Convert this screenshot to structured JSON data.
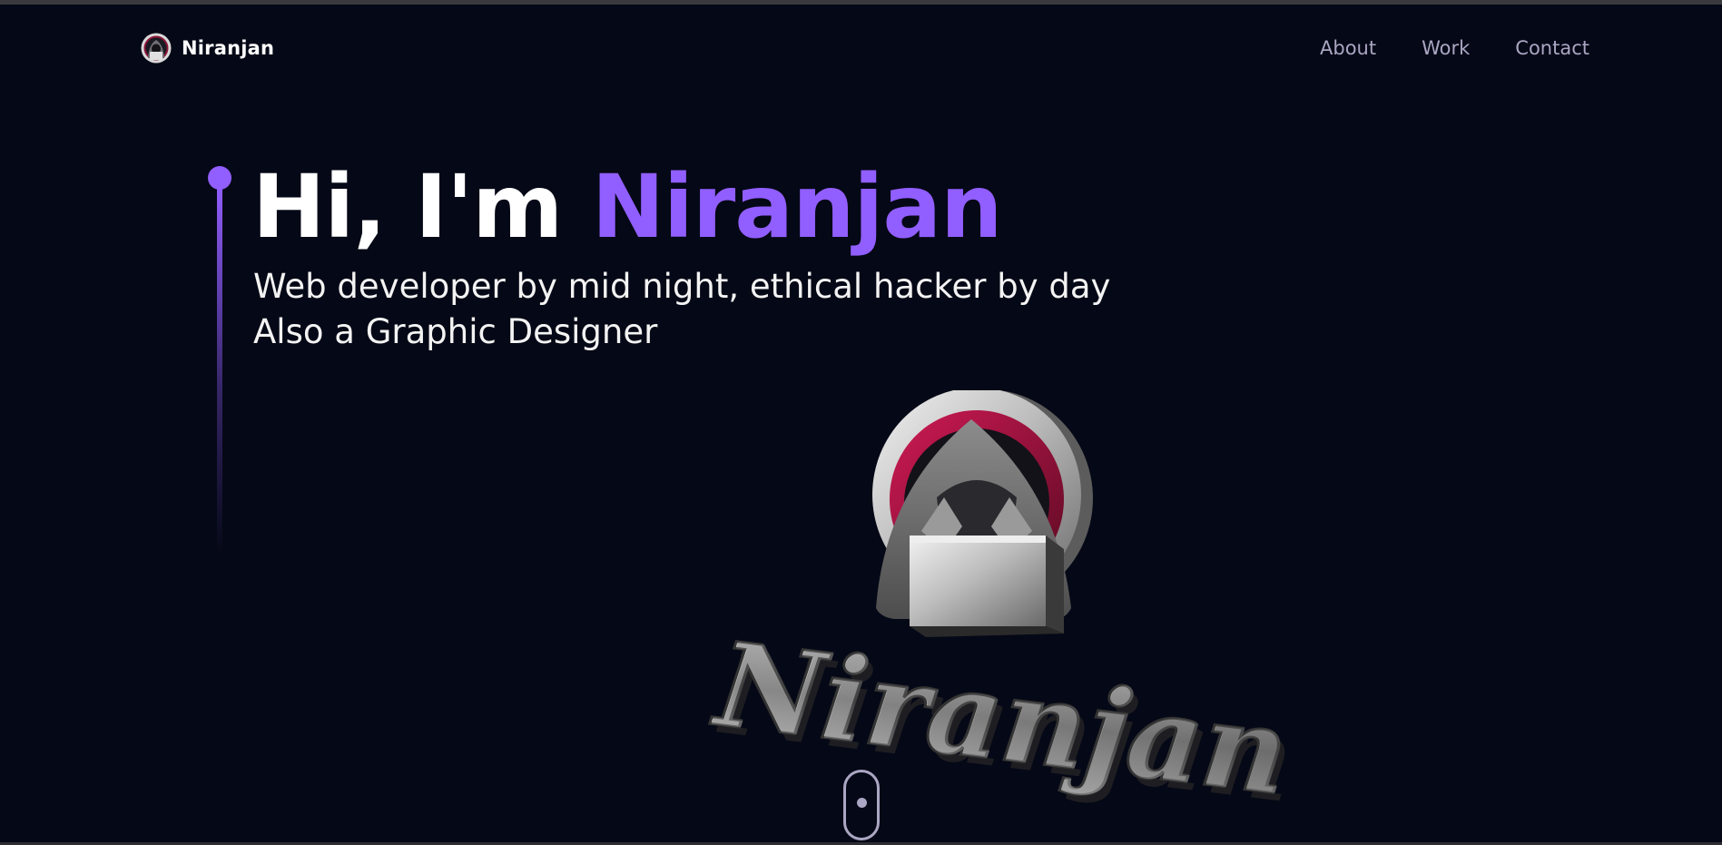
{
  "nav": {
    "brand": "Niranjan",
    "links": [
      "About",
      "Work",
      "Contact"
    ]
  },
  "hero": {
    "greeting": "Hi, I'm",
    "name": "Niranjan",
    "subtitle_line1": "Web developer by mid night, ethical hacker by day",
    "subtitle_line2": "Also a Graphic Designer"
  },
  "logo_3d": {
    "text": "Niranjan"
  },
  "colors": {
    "background": "#050816",
    "accent": "#915eff",
    "nav_link": "#aaa6c3",
    "emblem_ring": "#a0143f"
  },
  "icons": {
    "brand_logo": "hooded-hacker-icon",
    "scroll": "mouse-scroll-icon"
  }
}
